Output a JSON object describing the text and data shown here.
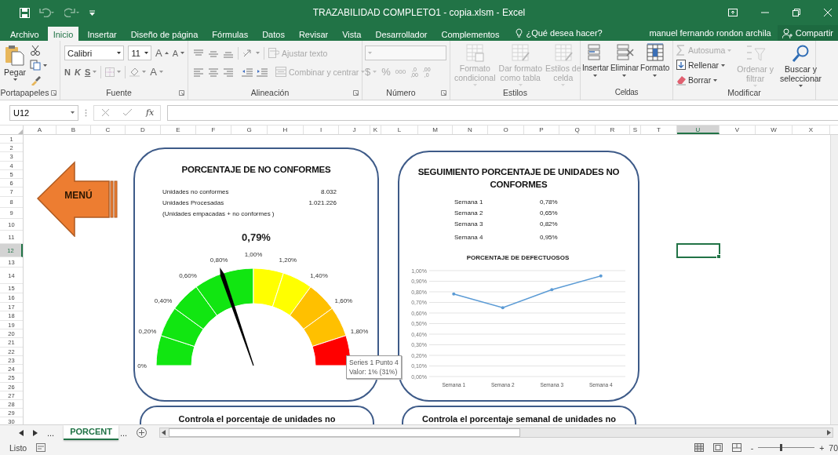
{
  "window": {
    "title": "TRAZABILIDAD COMPLETO1 - copia.xlsm - Excel"
  },
  "tabs": [
    {
      "label": "Archivo",
      "selected": false
    },
    {
      "label": "Inicio",
      "selected": true
    },
    {
      "label": "Insertar",
      "selected": false
    },
    {
      "label": "Diseño de página",
      "selected": false
    },
    {
      "label": "Fórmulas",
      "selected": false
    },
    {
      "label": "Datos",
      "selected": false
    },
    {
      "label": "Revisar",
      "selected": false
    },
    {
      "label": "Vista",
      "selected": false
    },
    {
      "label": "Desarrollador",
      "selected": false
    },
    {
      "label": "Complementos",
      "selected": false
    }
  ],
  "tell_me": "¿Qué desea hacer?",
  "user": "manuel fernando rondon archila",
  "share_button": "Compartir",
  "ribbon": {
    "clipboard": {
      "label": "Portapapeles",
      "paste": "Pegar"
    },
    "font": {
      "label": "Fuente",
      "name": "Calibri",
      "size": "11",
      "grow": "A",
      "shrink": "A",
      "bold": "N",
      "italic": "K",
      "underline": "S",
      "font_color": "A"
    },
    "alignment": {
      "label": "Alineación",
      "wrap_text": {
        "label": "Ajustar texto",
        "disabled": true
      },
      "merge": {
        "label": "Combinar y centrar",
        "disabled": true
      }
    },
    "number": {
      "label": "Número",
      "disabled": true,
      "currency": "$",
      "percent": "%",
      "thousands": "000",
      "more_decimals": [
        ",0",
        ",00"
      ],
      "fewer_decimals": [
        ",00",
        ",0"
      ]
    },
    "styles": {
      "label": "Estilos",
      "buttons": [
        {
          "lines": [
            "Formato",
            "condicional"
          ],
          "disabled": true
        },
        {
          "lines": [
            "Dar formato",
            "como tabla"
          ],
          "disabled": true
        },
        {
          "lines": [
            "Estilos de",
            "celda"
          ],
          "disabled": true
        }
      ]
    },
    "cells": {
      "label": "Celdas",
      "buttons": [
        {
          "label": "Insertar",
          "disabled": false
        },
        {
          "label": "Eliminar",
          "disabled": false
        },
        {
          "label": "Formato",
          "disabled": false
        }
      ]
    },
    "editing": {
      "label": "Modificar",
      "autosum": {
        "label": "Autosuma",
        "disabled": true
      },
      "fill": {
        "label": "Rellenar",
        "disabled": false
      },
      "clear": {
        "label": "Borrar",
        "disabled": false
      },
      "sort": {
        "lines": [
          "Ordenar y",
          "filtrar"
        ],
        "disabled": true
      },
      "find": {
        "lines": [
          "Buscar y",
          "seleccionar"
        ],
        "disabled": false
      }
    }
  },
  "name_box": "U12",
  "insert_function": "fx",
  "columns": [
    {
      "label": "A",
      "selected": false
    },
    {
      "label": "B",
      "selected": false
    },
    {
      "label": "C",
      "selected": false
    },
    {
      "label": "D",
      "selected": false
    },
    {
      "label": "E",
      "selected": false
    },
    {
      "label": "F",
      "selected": false
    },
    {
      "label": "G",
      "selected": false
    },
    {
      "label": "H",
      "selected": false
    },
    {
      "label": "I",
      "selected": false
    },
    {
      "label": "J",
      "selected": false
    },
    {
      "label": "K",
      "selected": false
    },
    {
      "label": "L",
      "selected": false
    },
    {
      "label": "M",
      "selected": false
    },
    {
      "label": "N",
      "selected": false
    },
    {
      "label": "O",
      "selected": false
    },
    {
      "label": "P",
      "selected": false
    },
    {
      "label": "Q",
      "selected": false
    },
    {
      "label": "R",
      "selected": false
    },
    {
      "label": "S",
      "selected": false
    },
    {
      "label": "T",
      "selected": false
    },
    {
      "label": "U",
      "selected": true
    },
    {
      "label": "V",
      "selected": false
    },
    {
      "label": "W",
      "selected": false
    },
    {
      "label": "X",
      "selected": false
    }
  ],
  "rows": [
    {
      "label": "1",
      "selected": false
    },
    {
      "label": "2",
      "selected": false
    },
    {
      "label": "3",
      "selected": false
    },
    {
      "label": "4",
      "selected": false
    },
    {
      "label": "5",
      "selected": false
    },
    {
      "label": "6",
      "selected": false
    },
    {
      "label": "7",
      "selected": false
    },
    {
      "label": "8",
      "selected": false
    },
    {
      "label": "9",
      "selected": false
    },
    {
      "label": "10",
      "selected": false
    },
    {
      "label": "11",
      "selected": false
    },
    {
      "label": "12",
      "selected": true
    },
    {
      "label": "13",
      "selected": false
    },
    {
      "label": "14",
      "selected": false
    },
    {
      "label": "15",
      "selected": false
    },
    {
      "label": "16",
      "selected": false
    },
    {
      "label": "17",
      "selected": false
    },
    {
      "label": "18",
      "selected": false
    },
    {
      "label": "19",
      "selected": false
    },
    {
      "label": "20",
      "selected": false
    },
    {
      "label": "21",
      "selected": false
    },
    {
      "label": "22",
      "selected": false
    },
    {
      "label": "23",
      "selected": false
    },
    {
      "label": "24",
      "selected": false
    },
    {
      "label": "25",
      "selected": false
    },
    {
      "label": "26",
      "selected": false
    },
    {
      "label": "27",
      "selected": false
    },
    {
      "label": "28",
      "selected": false
    },
    {
      "label": "29",
      "selected": false
    },
    {
      "label": "30",
      "selected": false
    }
  ],
  "sheet": {
    "menu_button": "MENÚ",
    "gauge_card": {
      "title": "PORCENTAJE DE NO CONFORMES",
      "stats": [
        {
          "label": "Unidades no conformes",
          "value": "8.032"
        },
        {
          "label": "Unidades Procesadas",
          "value": "1.021.226"
        }
      ],
      "note": "(Unidades empacadas + no conformes )",
      "result": "0,79%",
      "gauge": {
        "labels": [
          "0%",
          "0,20%",
          "0,40%",
          "0,60%",
          "0,80%",
          "1,00%",
          "1,20%",
          "1,40%",
          "1,60%",
          "1,80%"
        ],
        "segments": [
          {
            "color": "#11e611"
          },
          {
            "color": "#11e611"
          },
          {
            "color": "#11e611"
          },
          {
            "color": "#11e611"
          },
          {
            "color": "#11e611"
          },
          {
            "color": "#ffff00"
          },
          {
            "color": "#ffff00"
          },
          {
            "color": "#ffc000"
          },
          {
            "color": "#ffc000"
          },
          {
            "color": "#ff0000"
          }
        ]
      },
      "tooltip": [
        "Series 1 Punto 4",
        "Valor: 1% (31%)"
      ]
    },
    "trend_card": {
      "title": "SEGUIMIENTO PORCENTAJE DE UNIDADES NO CONFORMES",
      "weeks": [
        {
          "label": "Semana 1",
          "value": "0,78%"
        },
        {
          "label": "Semana 2",
          "value": "0,65%"
        },
        {
          "label": "Semana 3",
          "value": "0,82%"
        },
        {
          "label": "Semana 4",
          "value": "0,95%"
        }
      ],
      "chart_data": {
        "type": "line",
        "title": "PORCENTAJE DE DEFECTUOSOS",
        "categories": [
          "Semana 1",
          "Semana 2",
          "Semana 3",
          "Semana 4"
        ],
        "series": [
          {
            "color": "#5b9bd5",
            "values": [
              0.78,
              0.65,
              0.82,
              0.95
            ]
          }
        ],
        "ylim": [
          0,
          1
        ],
        "grid": true,
        "yticks": [
          {
            "value": 0,
            "label": "0,00%"
          },
          {
            "value": 0.1,
            "label": "0,10%"
          },
          {
            "value": 0.2,
            "label": "0,20%"
          },
          {
            "value": 0.3,
            "label": "0,30%"
          },
          {
            "value": 0.4,
            "label": "0,40%"
          },
          {
            "value": 0.5,
            "label": "0,50%"
          },
          {
            "value": 0.6,
            "label": "0,60%"
          },
          {
            "value": 0.7,
            "label": "0,70%"
          },
          {
            "value": 0.8,
            "label": "0,80%"
          },
          {
            "value": 0.9,
            "label": "0,90%"
          },
          {
            "value": 1,
            "label": "1,00%"
          }
        ]
      }
    },
    "note_cards": [
      "Controla el porcentaje de unidades no",
      "Controla el porcentaje semanal de unidades no"
    ]
  },
  "sheet_nav": {
    "more_left": "...",
    "more_right": "..."
  },
  "sheet_tabs": [
    {
      "label": "PORCENT",
      "selected": true
    }
  ],
  "status_bar": {
    "status": "Listo",
    "zoom_out": "-",
    "zoom_in": "+",
    "zoom": {
      "level": 0.4
    },
    "zoom_label": "70"
  }
}
